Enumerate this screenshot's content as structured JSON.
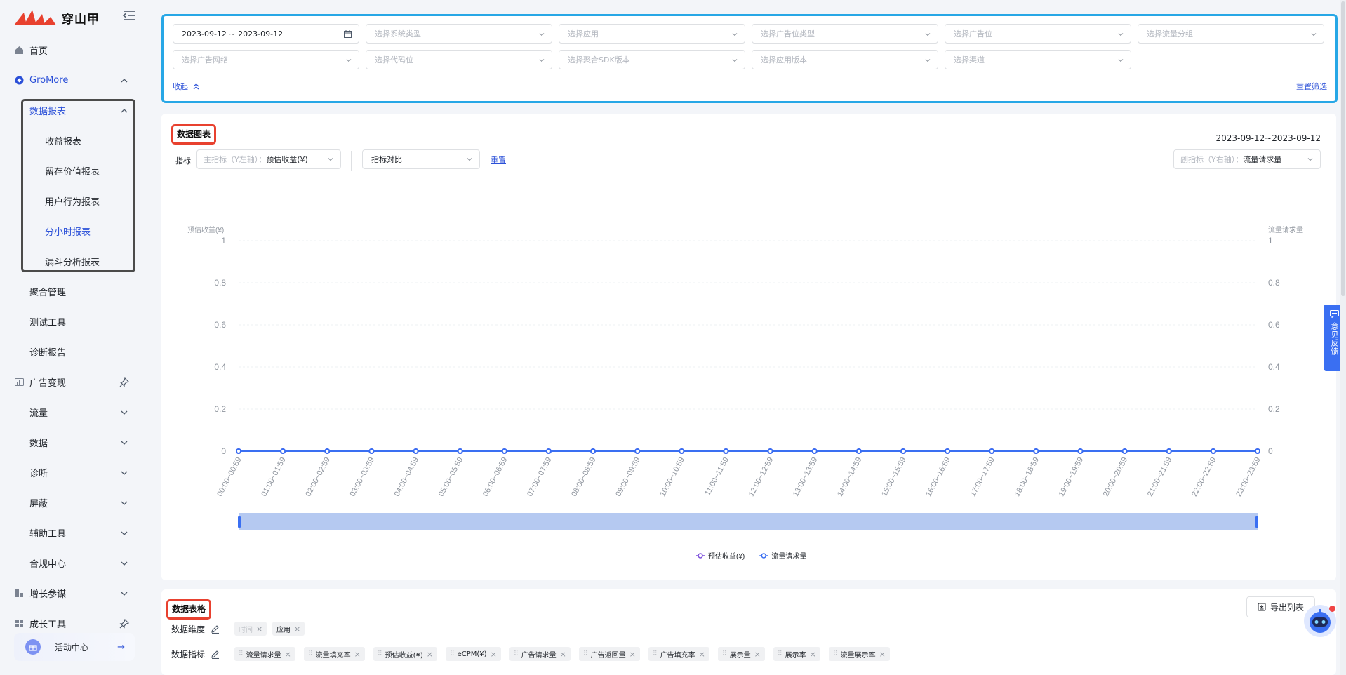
{
  "brand": {
    "name": "穿山甲"
  },
  "sidebar": {
    "items": [
      {
        "label": "首页",
        "icon": "home-icon"
      },
      {
        "label": "GroMore",
        "icon": "gromore-icon"
      },
      {
        "label": "数据报表"
      },
      {
        "label": "收益报表"
      },
      {
        "label": "留存价值报表"
      },
      {
        "label": "用户行为报表"
      },
      {
        "label": "分小时报表"
      },
      {
        "label": "漏斗分析报表"
      },
      {
        "label": "聚合管理"
      },
      {
        "label": "测试工具"
      },
      {
        "label": "诊断报告"
      },
      {
        "label": "广告变现",
        "icon": "monetization-icon"
      },
      {
        "label": "流量"
      },
      {
        "label": "数据"
      },
      {
        "label": "诊断"
      },
      {
        "label": "屏蔽"
      },
      {
        "label": "辅助工具"
      },
      {
        "label": "合规中心"
      },
      {
        "label": "增长参谋",
        "icon": "growth-icon"
      },
      {
        "label": "成长工具",
        "icon": "grid-icon"
      }
    ],
    "activity": {
      "label": "活动中心",
      "arrow": "→"
    }
  },
  "filters": {
    "date_range": "2023-09-12 ~ 2023-09-12",
    "placeholders": [
      "选择系统类型",
      "选择应用",
      "选择广告位类型",
      "选择广告位",
      "选择流量分组",
      "选择广告网络",
      "选择代码位",
      "选择聚合SDK版本",
      "选择应用版本",
      "选择渠道"
    ],
    "collapse_label": "收起",
    "reset_label": "重置筛选"
  },
  "chart_section": {
    "title": "数据图表",
    "date_range": "2023-09-12~2023-09-12",
    "metric_label": "指标",
    "primary_prefix": "主指标（Y左轴）：",
    "primary_value": "预估收益(¥)",
    "compare_label": "指标对比",
    "reset_label": "重置",
    "secondary_prefix": "副指标（Y右轴）：",
    "secondary_value": "流量请求量"
  },
  "chart_data": {
    "type": "line",
    "x": [
      "00:00~00:59",
      "01:00~01:59",
      "02:00~02:59",
      "03:00~03:59",
      "04:00~04:59",
      "05:00~05:59",
      "06:00~06:59",
      "07:00~07:59",
      "08:00~08:59",
      "09:00~09:59",
      "10:00~10:59",
      "11:00~11:59",
      "12:00~12:59",
      "13:00~13:59",
      "14:00~14:59",
      "15:00~15:59",
      "16:00~16:59",
      "17:00~17:59",
      "18:00~18:59",
      "19:00~19:59",
      "20:00~20:59",
      "21:00~21:59",
      "22:00~22:59",
      "23:00~23:59"
    ],
    "series": [
      {
        "name": "预估收益(¥)",
        "axis": "left",
        "color": "#7b4ddb",
        "values": [
          0,
          0,
          0,
          0,
          0,
          0,
          0,
          0,
          0,
          0,
          0,
          0,
          0,
          0,
          0,
          0,
          0,
          0,
          0,
          0,
          0,
          0,
          0,
          0
        ]
      },
      {
        "name": "流量请求量",
        "axis": "right",
        "color": "#3a6ff2",
        "values": [
          0,
          0,
          0,
          0,
          0,
          0,
          0,
          0,
          0,
          0,
          0,
          0,
          0,
          0,
          0,
          0,
          0,
          0,
          0,
          0,
          0,
          0,
          0,
          0
        ]
      }
    ],
    "ylabel": "预估收益(¥)",
    "y2label": "流量请求量",
    "ylim": [
      0,
      1
    ],
    "y2lim": [
      0,
      1
    ],
    "yticks": [
      "0",
      "0.2",
      "0.4",
      "0.6",
      "0.8",
      "1"
    ],
    "grid": true,
    "legend": "bottom"
  },
  "table_section": {
    "title": "数据表格",
    "export_label": "导出列表",
    "dimension_label": "数据维度",
    "dimensions": [
      {
        "label": "时间",
        "disabled": true
      },
      {
        "label": "应用",
        "disabled": false
      }
    ],
    "metric_label": "数据指标",
    "metrics": [
      "流量请求量",
      "流量填充率",
      "预估收益(¥)",
      "eCPM(¥)",
      "广告请求量",
      "广告返回量",
      "广告填充率",
      "展示量",
      "展示率",
      "流量展示率"
    ]
  },
  "feedback": {
    "label": "意见反馈"
  },
  "colors": {
    "accent": "#2b50d8",
    "highlight_border": "#27a7e6",
    "title_border": "#e8412f"
  }
}
